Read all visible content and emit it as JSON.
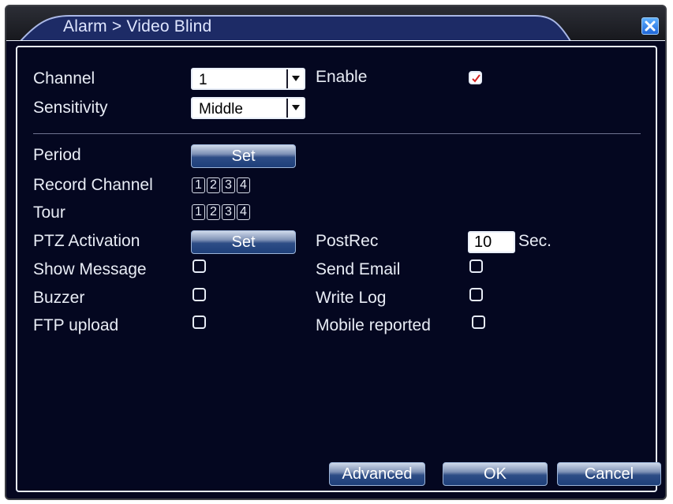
{
  "window": {
    "title": "Alarm > Video Blind"
  },
  "form": {
    "channel_label": "Channel",
    "channel_value": "1",
    "enable_label": "Enable",
    "enable_checked": true,
    "sensitivity_label": "Sensitivity",
    "sensitivity_value": "Middle",
    "period_label": "Period",
    "period_button": "Set",
    "record_channel_label": "Record Channel",
    "record_channels": [
      "1",
      "2",
      "3",
      "4"
    ],
    "tour_label": "Tour",
    "tour_channels": [
      "1",
      "2",
      "3",
      "4"
    ],
    "ptz_label": "PTZ Activation",
    "ptz_button": "Set",
    "postrec_label": "PostRec",
    "postrec_value": "10",
    "postrec_unit": "Sec.",
    "show_message_label": "Show Message",
    "send_email_label": "Send Email",
    "buzzer_label": "Buzzer",
    "write_log_label": "Write Log",
    "ftp_upload_label": "FTP upload",
    "mobile_reported_label": "Mobile reported"
  },
  "footer": {
    "advanced_label": "Advanced",
    "ok_label": "OK",
    "cancel_label": "Cancel"
  },
  "colors": {
    "background": "#040720",
    "text": "#e8ecf5",
    "button_dark": "#1e3f7a"
  }
}
